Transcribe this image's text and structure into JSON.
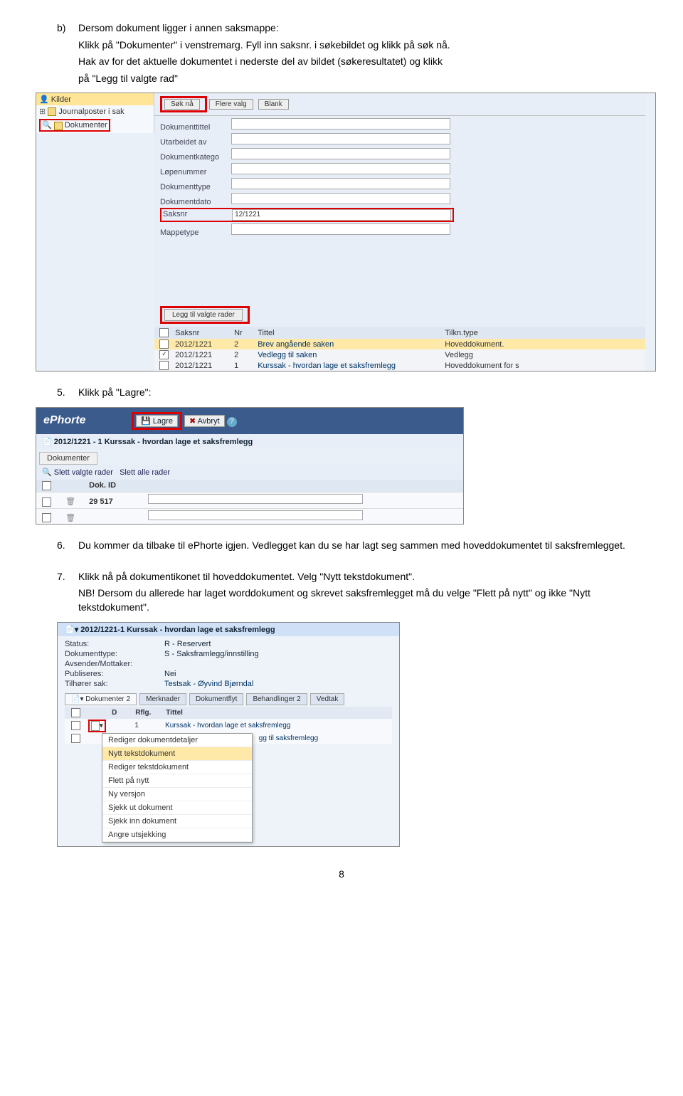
{
  "body": {
    "item_b": "b)",
    "item_b_text": "Dersom dokument ligger i annen saksmappe:",
    "line1": "Klikk på \"Dokumenter\" i venstremarg. Fyll inn saksnr. i søkebildet og klikk på søk nå.",
    "line2": "Hak av for det aktuelle dokumentet i nederste del av bildet (søkeresultatet) og klikk",
    "line3": "på \"Legg til valgte rad\"",
    "step5": "5.",
    "step5_text": "Klikk på \"Lagre\":",
    "step6": "6.",
    "step6_text": "Du kommer da tilbake til ePhorte igjen. Vedlegget kan du se har lagt seg sammen med hoveddokumentet til saksfremlegget.",
    "step7": "7.",
    "step7_text": "Klikk nå på dokumentikonet til hoveddokumentet. Velg \"Nytt tekstdokument\".",
    "step7_nb": "NB! Dersom du allerede har laget worddokument og skrevet saksfremlegget må du velge \"Flett på nytt\" og ikke \"Nytt tekstdokument\".",
    "page": "8"
  },
  "ss1": {
    "tree_hdr": "Kilder",
    "tree_r1": "Journalposter i sak",
    "tree_r2": "Dokumenter",
    "btn_search": "Søk nå",
    "btn_more": "Flere valg",
    "btn_blank": "Blank",
    "f1": "Dokumenttittel",
    "f2": "Utarbeidet av",
    "f3": "Dokumentkatego",
    "f4": "Løpenummer",
    "f5": "Dokumenttype",
    "f6": "Dokumentdato",
    "f7": "Saksnr",
    "f7_val": "12/1221",
    "f8": "Mappetype",
    "addbtn": "Legg til valgte rader",
    "th_saksnr": "Saksnr",
    "th_nr": "Nr",
    "th_tittel": "Tittel",
    "th_tilkn": "Tilkn.type",
    "r1": {
      "s": "2012/1221",
      "n": "2",
      "t": "Brev angående saken",
      "tk": "Hoveddokument."
    },
    "r2": {
      "s": "2012/1221",
      "n": "2",
      "t": "Vedlegg til saken",
      "tk": "Vedlegg"
    },
    "r3": {
      "s": "2012/1221",
      "n": "1",
      "t": "Kurssak - hvordan lage et saksfremlegg",
      "tk": "Hoveddokument for s"
    }
  },
  "ss2": {
    "brand": "ePhorte",
    "btn_save": "Lagre",
    "btn_cancel": "Avbryt",
    "title": "2012/1221 - 1   Kurssak - hvordan lage et saksfremlegg",
    "tab": "Dokumenter",
    "tool1": "Slett valgte rader",
    "tool2": "Slett alle rader",
    "th_id": "Dok. ID",
    "row_id": "29 517"
  },
  "ss3": {
    "hdr": "2012/1221-1 Kurssak - hvordan lage et saksfremlegg",
    "r1l": "Status:",
    "r1v": "R - Reservert",
    "r2l": "Dokumenttype:",
    "r2v": "S - Saksframlegg/innstilling",
    "r3l": "Avsender/Mottaker:",
    "r4l": "Publiseres:",
    "r4v": "Nei",
    "r5l": "Tilhører sak:",
    "r5v": "Testsak - Øyvind Bjørndal",
    "tab1": "Dokumenter 2",
    "tab2": "Merknader",
    "tab3": "Dokumentflyt",
    "tab4": "Behandlinger 2",
    "tab5": "Vedtak",
    "th_d": "D",
    "th_rfg": "Rflg.",
    "th_t": "Tittel",
    "drow1_n": "1",
    "drow1_t": "Kurssak - hvordan lage et saksfremlegg",
    "drow2_t": "gg til saksfremlegg",
    "dd0": "Rediger dokumentdetaljer",
    "dd1": "Nytt tekstdokument",
    "dd2": "Rediger tekstdokument",
    "dd3": "Flett på nytt",
    "dd4": "Ny versjon",
    "dd5": "Sjekk ut dokument",
    "dd6": "Sjekk inn dokument",
    "dd7": "Angre utsjekking"
  }
}
